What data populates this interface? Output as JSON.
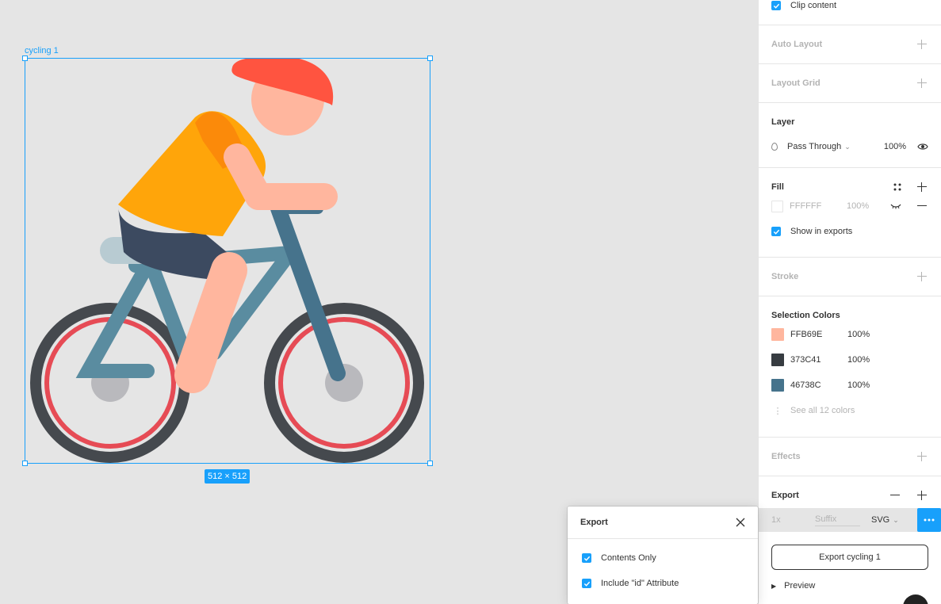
{
  "canvas": {
    "frame_name": "cycling 1",
    "frame_size": "512 × 512"
  },
  "panel": {
    "clip_content": "Clip content",
    "auto_layout": "Auto Layout",
    "layout_grid": "Layout Grid",
    "layer": {
      "title": "Layer",
      "blend_mode": "Pass Through",
      "opacity": "100%"
    },
    "fill": {
      "title": "Fill",
      "hex": "FFFFFF",
      "opacity": "100%",
      "show_in_exports": "Show in exports"
    },
    "stroke": "Stroke",
    "selection_colors": {
      "title": "Selection Colors",
      "items": [
        {
          "hex": "FFB69E",
          "opacity": "100%",
          "color": "#FFB69E"
        },
        {
          "hex": "373C41",
          "opacity": "100%",
          "color": "#373C41"
        },
        {
          "hex": "46738C",
          "opacity": "100%",
          "color": "#46738C"
        }
      ],
      "see_all": "See all 12 colors"
    },
    "effects": "Effects",
    "export": {
      "title": "Export",
      "scale": "1x",
      "suffix": "Suffix",
      "format": "SVG",
      "button": "Export cycling 1",
      "preview": "Preview"
    }
  },
  "popup": {
    "title": "Export",
    "options": [
      {
        "label": "Contents Only",
        "checked": true
      },
      {
        "label": "Include \"id\" Attribute",
        "checked": true
      }
    ]
  },
  "colors": {
    "accent": "#18A0FB",
    "helmet": "#FF5440",
    "shirt": "#FFA50A",
    "skin": "#FFB69E",
    "frame": "#5A8CA0",
    "tire": "#373C41",
    "rim": "#E6505A"
  }
}
